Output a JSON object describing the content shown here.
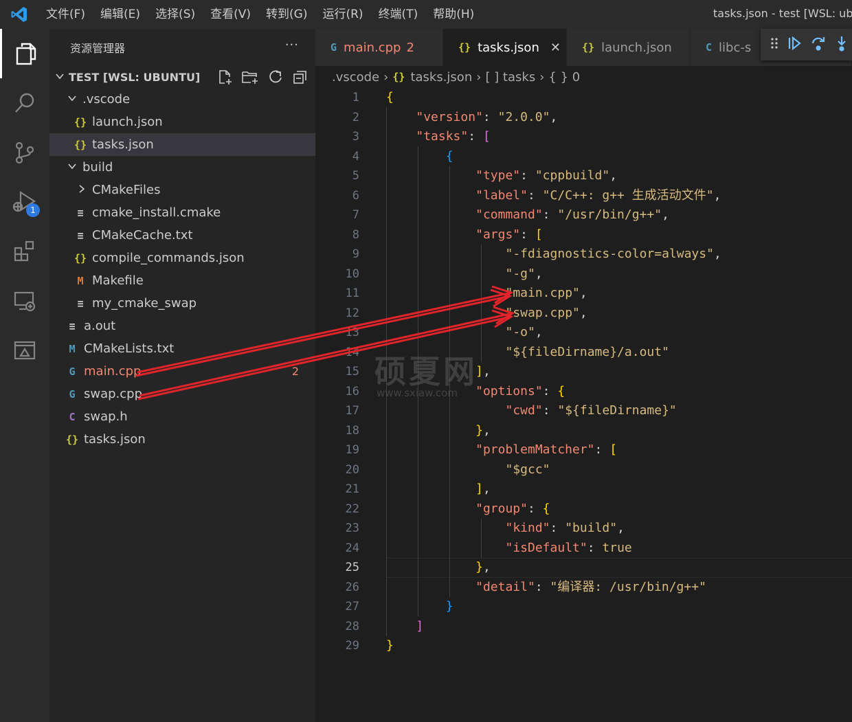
{
  "menu": [
    "文件(F)",
    "编辑(E)",
    "选择(S)",
    "查看(V)",
    "转到(G)",
    "运行(R)",
    "终端(T)",
    "帮助(H)"
  ],
  "window_title": "tasks.json - test [WSL: ubu",
  "activity_bar": {
    "debug_badge": "1"
  },
  "sidebar": {
    "title": "资源管理器",
    "more": "···",
    "section": "TEST [WSL: UBUNTU]",
    "items": [
      {
        "label": "vscode",
        "prefix": "."
      },
      {
        "label": "launch.json",
        "icon": "{}"
      },
      {
        "label": "tasks.json",
        "icon": "{}"
      },
      {
        "label": "build"
      },
      {
        "label": "CMakeFiles"
      },
      {
        "label": "cmake_install.cmake",
        "icon": "≡"
      },
      {
        "label": "CMakeCache.txt",
        "icon": "≡"
      },
      {
        "label": "compile_commands.json",
        "icon": "{}"
      },
      {
        "label": "Makefile",
        "icon": "M"
      },
      {
        "label": "my_cmake_swap",
        "icon": "≡"
      },
      {
        "label": "a.out",
        "icon": "≡"
      },
      {
        "label": "CMakeLists.txt",
        "icon": "M"
      },
      {
        "label": "main.cpp",
        "icon": "G",
        "count": "2"
      },
      {
        "label": "swap.cpp",
        "icon": "G"
      },
      {
        "label": "swap.h",
        "icon": "C"
      },
      {
        "label": "tasks.json",
        "icon": "{}"
      }
    ]
  },
  "tabs": [
    {
      "label": "main.cpp",
      "count": "2",
      "icon": "G"
    },
    {
      "label": "tasks.json",
      "icon": "{}",
      "close": "✕"
    },
    {
      "label": "launch.json",
      "icon": "{}"
    },
    {
      "label": "libc-s",
      "icon": "C"
    }
  ],
  "breadcrumb": [
    ".vscode",
    "tasks.json",
    "[ ] tasks",
    "{ } 0"
  ],
  "breadcrumb_icon": "{}",
  "editor": {
    "current_line": 25,
    "line_numbers": [
      "1",
      "2",
      "3",
      "4",
      "5",
      "6",
      "7",
      "8",
      "9",
      "10",
      "11",
      "12",
      "13",
      "14",
      "15",
      "16",
      "17",
      "18",
      "19",
      "20",
      "21",
      "22",
      "23",
      "24",
      "25",
      "26",
      "27",
      "28",
      "29"
    ],
    "code_lines": [
      "{",
      "    \"version\": \"2.0.0\",",
      "    \"tasks\": [",
      "        {",
      "            \"type\": \"cppbuild\",",
      "            \"label\": \"C/C++: g++ 生成活动文件\",",
      "            \"command\": \"/usr/bin/g++\",",
      "            \"args\": [",
      "                \"-fdiagnostics-color=always\",",
      "                \"-g\",",
      "                \"main.cpp\",",
      "                \"swap.cpp\",",
      "                \"-o\",",
      "                \"${fileDirname}/a.out\"",
      "            ],",
      "            \"options\": {",
      "                \"cwd\": \"${fileDirname}\"",
      "            },",
      "            \"problemMatcher\": [",
      "                \"$gcc\"",
      "            ],",
      "            \"group\": {",
      "                \"kind\": \"build\",",
      "                \"isDefault\": true",
      "            },",
      "            \"detail\": \"编译器: /usr/bin/g++\"",
      "        }",
      "    ]",
      "}"
    ]
  },
  "watermark": {
    "main": "硕夏网",
    "sub": "www.sxiaw.com"
  },
  "colors": {
    "arrow": "#e0242a",
    "accent": "#2d7be0",
    "error": "#f48771"
  }
}
